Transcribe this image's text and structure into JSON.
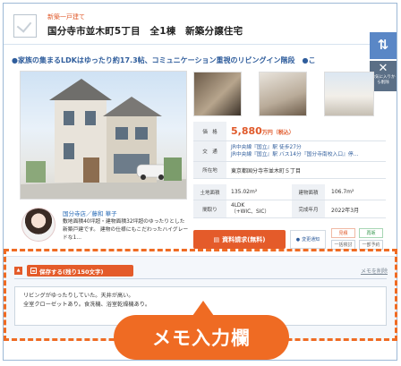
{
  "header": {
    "type_label": "新築一戸建て",
    "title": "国分寺市並木町5丁目　全1棟　新築分譲住宅"
  },
  "side_buttons": {
    "sort_glyph": "⇅",
    "delete_glyph": "✕",
    "delete_text": "お気に入りから削除"
  },
  "catch_copy": "●家族の集まるLDKはゆったり約17.3帖、コミュニケーション重視のリビングイン階段　●こ",
  "details": {
    "price_label": "価　格",
    "price_value": "5,880",
    "price_unit": "万円（税込）",
    "transport_label": "交　通",
    "transport_line1": "JR中央線『国立』駅 徒歩27分",
    "transport_line2": "JR中央線『国立』駅 バス14分『国分寺南校入口』停…",
    "address_label": "所在地",
    "address_value": "東京都国分寺市並木町５丁目",
    "land_label": "土地面積",
    "land_value": "135.02m²",
    "building_label": "建物面積",
    "building_value": "106.7m²",
    "layout_label": "間取り",
    "layout_value": "4LDK",
    "layout_note": "（+WIC、SIC）",
    "completion_label": "完成年月",
    "completion_value": "2022年3月"
  },
  "agent": {
    "name": "国分寺店／藤和 華子",
    "comment": "敷地面積40坪超・建物面積32坪超のゆったりとした新築戸建です。 建物の仕様にもこだわったハイグレードな1…"
  },
  "actions": {
    "request_label": "資料請求(無料)",
    "notify_label": "変更通知",
    "tags": [
      "見積",
      "再販",
      "一括検討",
      "一部予約"
    ]
  },
  "memo": {
    "collapse_glyph": "▲",
    "save_label": "保存する(残り150文字)",
    "delete_label": "メモを削除",
    "text": "リビングがゆったりしていた。天井が高い。\n全室クローゼットあり。食洗機、浴室乾燥機あり。"
  },
  "callout": {
    "label": "メモ入力欄"
  },
  "colors": {
    "accent": "#e45b2a",
    "link_blue": "#2f5d9c",
    "side_button": "#5a87c6"
  }
}
